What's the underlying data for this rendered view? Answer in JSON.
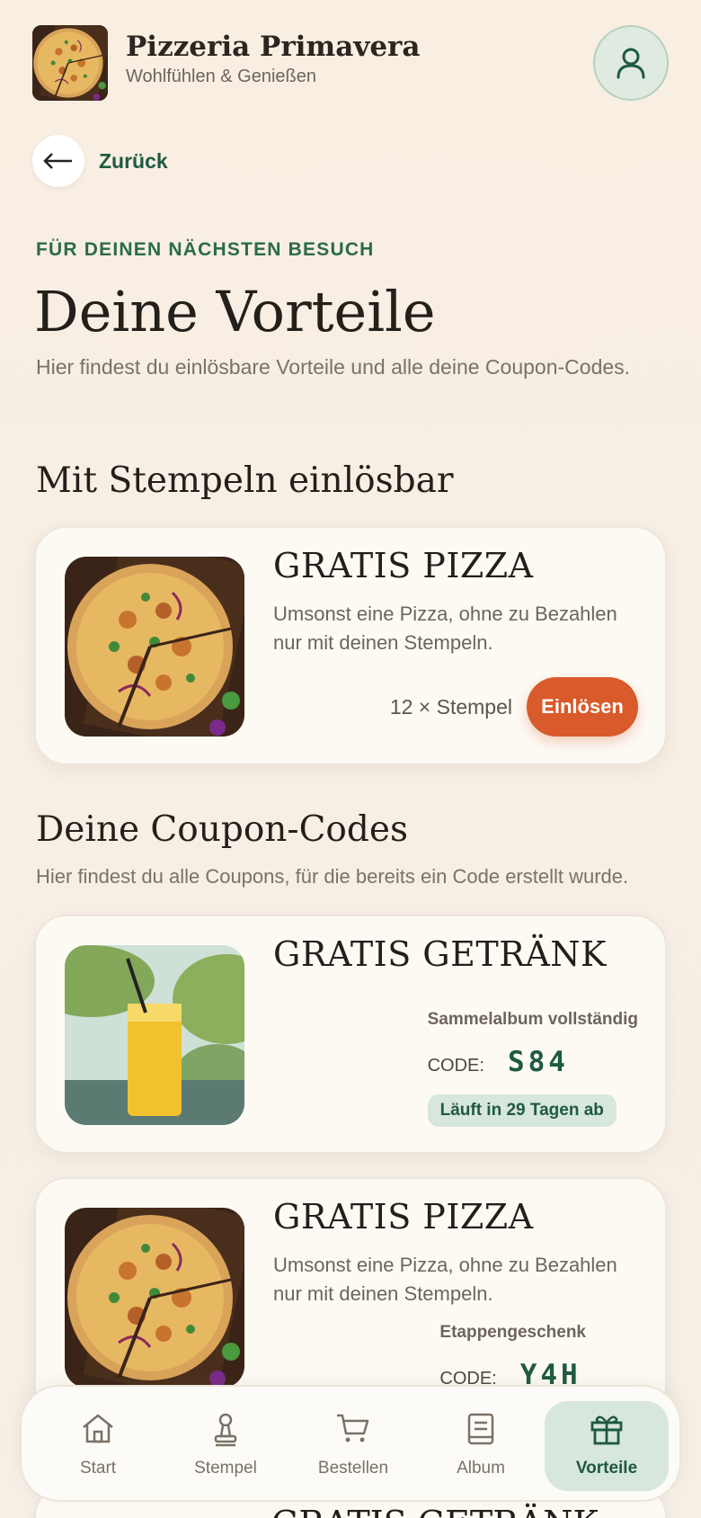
{
  "header": {
    "brand_name": "Pizzeria Primavera",
    "tagline": "Wohlfühlen & Genießen",
    "logo_icon": "pizza-image",
    "profile_icon": "user-icon"
  },
  "back": {
    "label": "Zurück",
    "icon": "arrow-left-icon"
  },
  "hero": {
    "eyebrow": "FÜR DEINEN NÄCHSTEN BESUCH",
    "title": "Deine Vorteile",
    "intro": "Hier findest du einlösbare Vorteile und alle deine Coupon-Codes."
  },
  "stamp_section": {
    "title": "Mit Stempeln einlösbar",
    "rewards": [
      {
        "title": "GRATIS PIZZA",
        "description": "Umsonst eine Pizza, ohne zu Bezahlen nur mit deinen Stempeln.",
        "cost": "12 × Stempel",
        "button": "Einlösen",
        "image": "pizza-image"
      }
    ]
  },
  "coupon_section": {
    "title": "Deine Coupon-Codes",
    "subtitle": "Hier findest du alle Coupons, für die bereits ein Code erstellt wurde.",
    "coupons": [
      {
        "title": "GRATIS GETRÄNK",
        "origin": "Sammelalbum vollständig",
        "code_label": "CODE:",
        "code": "S84",
        "expiry": "Läuft in 29 Tagen ab",
        "image": "drink-image"
      },
      {
        "title": "GRATIS PIZZA",
        "description": "Umsonst eine Pizza, ohne zu Bezahlen nur mit deinen Stempeln.",
        "origin": "Etappengeschenk",
        "code_label": "CODE:",
        "code": "Y4H",
        "image": "pizza-image"
      },
      {
        "title": "GRATIS GETRÄNK"
      }
    ]
  },
  "bottom_nav": {
    "items": [
      {
        "label": "Start",
        "icon": "home-icon"
      },
      {
        "label": "Stempel",
        "icon": "stamp-icon"
      },
      {
        "label": "Bestellen",
        "icon": "cart-icon"
      },
      {
        "label": "Album",
        "icon": "book-icon"
      },
      {
        "label": "Vorteile",
        "icon": "gift-icon",
        "active": true
      }
    ]
  },
  "colors": {
    "accent_green": "#1f5a40",
    "accent_orange": "#d95a2b",
    "background": "#f8eee2",
    "chip_green": "#d7e7dc"
  }
}
